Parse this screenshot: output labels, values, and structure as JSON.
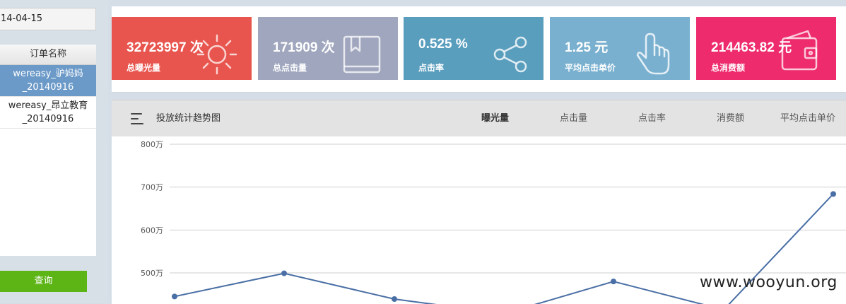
{
  "sidebar": {
    "date_value": "14-04-15",
    "order_header": "订单名称",
    "orders": [
      {
        "line1": "wereasy_驴妈妈",
        "line2": "_20140916"
      },
      {
        "line1": "wereasy_昂立教育",
        "line2": "_20140916"
      }
    ],
    "query_button": "查询"
  },
  "stats": [
    {
      "value": "32723997 次",
      "label": "总曝光量",
      "color": "#e8554e",
      "icon": "sun-icon"
    },
    {
      "value": "171909 次",
      "label": "总点击量",
      "color": "#9fa6bd",
      "icon": "book-icon"
    },
    {
      "value": "0.525 %",
      "label": "点击率",
      "color": "#5a9ebe",
      "icon": "share-icon"
    },
    {
      "value": "1.25 元",
      "label": "平均点击单价",
      "color": "#79b0cf",
      "icon": "hand-pointer-icon"
    },
    {
      "value": "214463.82 元",
      "label": "总消费额",
      "color": "#ee2b6c",
      "icon": "wallet-icon"
    }
  ],
  "chart": {
    "title": "投放统计趋势图",
    "tabs": [
      "曝光量",
      "点击量",
      "点击率",
      "消费额",
      "平均点击单价"
    ],
    "active_tab": "曝光量"
  },
  "chart_data": {
    "type": "line",
    "y_ticks": [
      "800万",
      "700万",
      "600万",
      "500万"
    ],
    "ylim": [
      430,
      800
    ],
    "series": [
      {
        "values": [
          445,
          499,
          439,
          405,
          480,
          414,
          684
        ]
      }
    ],
    "line_color": "#4a6fa5"
  },
  "watermark": "www.wooyun.org"
}
